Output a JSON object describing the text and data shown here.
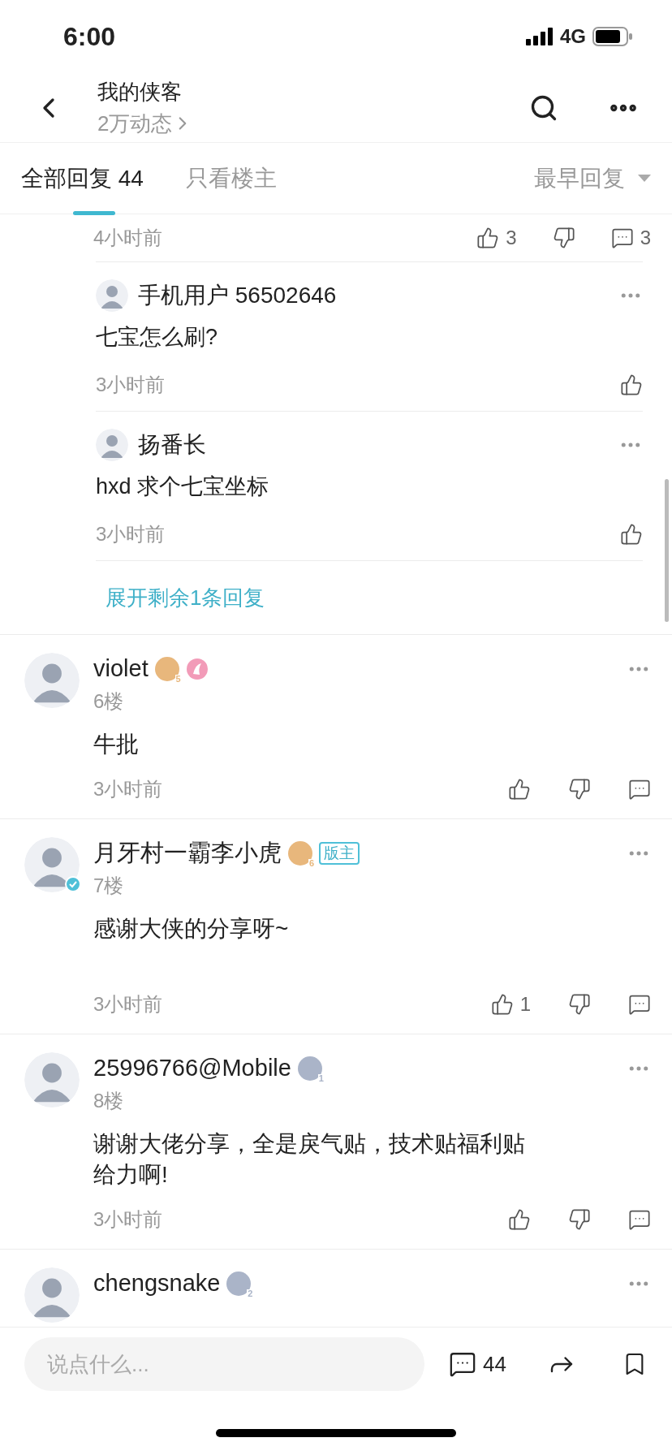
{
  "status_bar": {
    "time": "6:00",
    "network": "4G"
  },
  "header": {
    "title": "我的侠客",
    "subtitle": "2万动态"
  },
  "tabs": [
    {
      "label": "全部回复",
      "count": "44",
      "selected": true
    },
    {
      "label": "只看楼主",
      "selected": false
    }
  ],
  "sort": {
    "label": "最早回复"
  },
  "previous_comment": {
    "time": "4小时前",
    "likes": "3",
    "replies": "3"
  },
  "sub_replies": [
    {
      "name": "手机用户 56502646",
      "content": "七宝怎么刷?",
      "time": "3小时前"
    },
    {
      "name": "扬番长",
      "content": "hxd 求个七宝坐标",
      "time": "3小时前"
    }
  ],
  "expand_link": "展开剩余1条回复",
  "comments": [
    {
      "name": "violet",
      "level": "5",
      "color": "#e8b77c",
      "medal": true,
      "verified": false,
      "floor": "6楼",
      "content": "牛批",
      "time": "3小时前"
    },
    {
      "name": "月牙村一霸李小虎",
      "level": "6",
      "color": "#e8b77c",
      "medal": false,
      "verified": true,
      "tag": "版主",
      "floor": "7楼",
      "content": "感谢大侠的分享呀~\n",
      "time": "3小时前",
      "likes": "1"
    },
    {
      "name": "25996766@Mobile",
      "level": "1",
      "color": "#aab4c8",
      "medal": false,
      "verified": false,
      "floor": "8楼",
      "content": "谢谢大佬分享，全是戾气贴，技术贴福利贴给力啊!",
      "time": "3小时前"
    },
    {
      "name": "chengsnake",
      "level": "2",
      "color": "#aab4c8",
      "medal": false,
      "verified": false
    }
  ],
  "bottom_bar": {
    "placeholder": "说点什么...",
    "comment_count": "44"
  }
}
